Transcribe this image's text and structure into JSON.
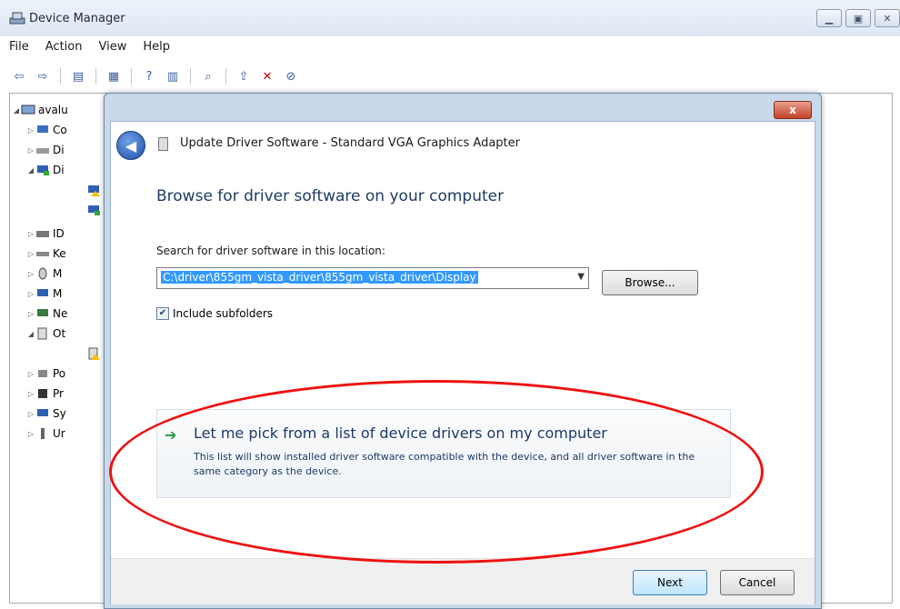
{
  "window": {
    "title": "Device Manager",
    "caption_buttons": [
      "minimize",
      "restore",
      "close"
    ]
  },
  "menu": {
    "items": [
      "File",
      "Action",
      "View",
      "Help"
    ]
  },
  "toolbar": {
    "icons": [
      "back-arrow-icon",
      "forward-arrow-icon",
      "show-hide-console-tree-icon",
      "properties-icon",
      "help-icon",
      "action-pane-icon",
      "scan-hardware-icon",
      "update-driver-icon",
      "uninstall-icon",
      "disable-icon"
    ]
  },
  "tree": {
    "root_label": "avalu",
    "children": [
      "Co",
      "Di",
      "Di",
      "",
      "",
      "ID",
      "Ke",
      "M",
      "M",
      "Ne",
      "Ot",
      "",
      "Po",
      "Pr",
      "Sy",
      "Ur"
    ]
  },
  "dialog": {
    "close_label": "x",
    "header_title": "Update Driver Software - Standard VGA Graphics Adapter",
    "main_title": "Browse for driver software on your computer",
    "search_label": "Search for driver software in this location:",
    "path_value": "C:\\driver\\855gm_vista_driver\\855gm_vista_driver\\Display",
    "browse_label": "Browse...",
    "include_subfolders_label": "Include subfolders",
    "include_subfolders_checked": true,
    "pick_title": "Let me pick from a list of device drivers on my computer",
    "pick_desc": "This list will show installed driver software compatible with the device, and all driver software in the same category as the device.",
    "next_label": "Next",
    "cancel_label": "Cancel"
  },
  "colors": {
    "highlight": "#e11111",
    "link_blue": "#1e3a66",
    "selection": "#3399ff"
  }
}
